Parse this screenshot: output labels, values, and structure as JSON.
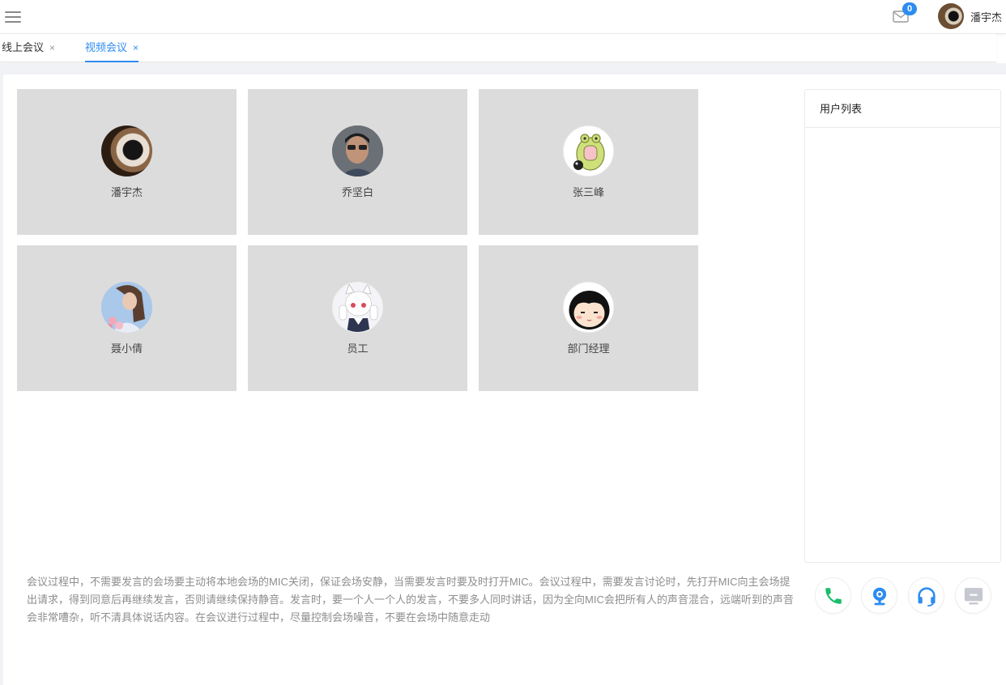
{
  "header": {
    "mail_badge": "0",
    "user_name": "潘宇杰"
  },
  "tabs": [
    {
      "label": "线上会议",
      "close": "×",
      "active": false
    },
    {
      "label": "视频会议",
      "close": "×",
      "active": true
    }
  ],
  "participants": [
    {
      "name": "潘宇杰",
      "avatar": "dog-nose-avatar"
    },
    {
      "name": "乔坚白",
      "avatar": "man-glasses-avatar"
    },
    {
      "name": "张三峰",
      "avatar": "frog-cartoon-avatar"
    },
    {
      "name": "聂小倩",
      "avatar": "girl-flowers-avatar"
    },
    {
      "name": "员工",
      "avatar": "anime-cat-girl-avatar"
    },
    {
      "name": "部门经理",
      "avatar": "cartoon-girl-avatar"
    }
  ],
  "user_list": {
    "title": "用户列表"
  },
  "notice": "会议过程中，不需要发言的会场要主动将本地会场的MIC关闭，保证会场安静，当需要发言时要及时打开MIC。会议过程中，需要发言讨论时，先打开MIC向主会场提出请求，得到同意后再继续发言，否则请继续保持静音。发言时，要一个人一个人的发言，不要多人同时讲话，因为全向MIC会把所有人的声音混合，远端听到的声音会非常嘈杂，听不清具体说话内容。在会议进行过程中，尽量控制会场噪音，不要在会场中随意走动",
  "controls": [
    {
      "icon": "phone-icon",
      "color": "#19be6b"
    },
    {
      "icon": "webcam-icon",
      "color": "#2d8cf0"
    },
    {
      "icon": "headset-icon",
      "color": "#2d8cf0"
    },
    {
      "icon": "screen-share-icon",
      "color": "#c5c8ce"
    }
  ],
  "colors": {
    "accent": "#2d8cf0",
    "tile_bg": "#dcdcdc",
    "call_green": "#19be6b"
  }
}
